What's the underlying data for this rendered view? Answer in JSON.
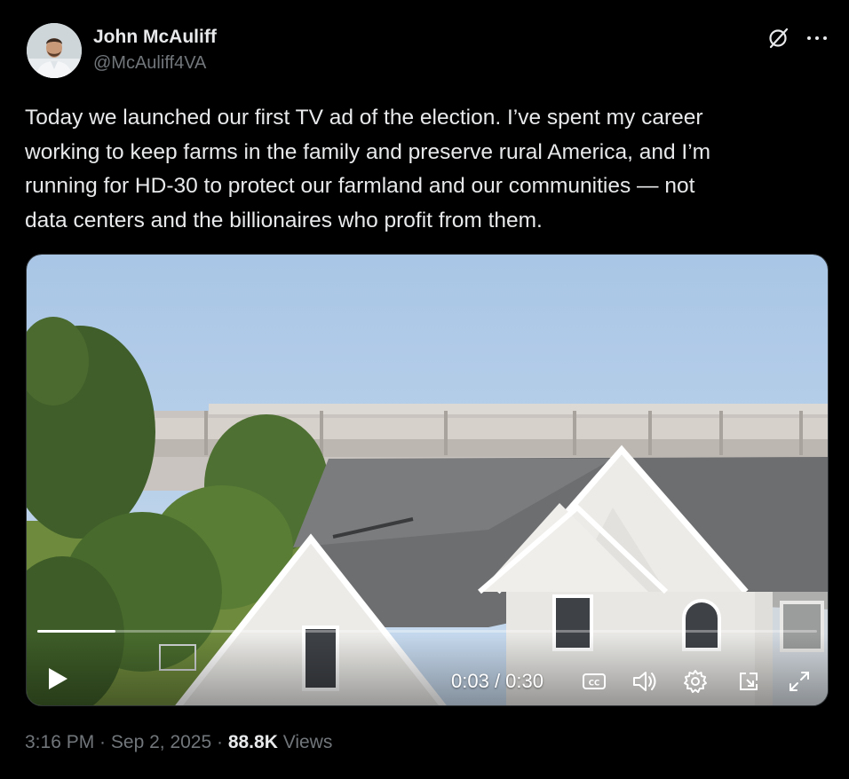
{
  "author": {
    "display_name": "John McAuliff",
    "handle": "@McAuliff4VA"
  },
  "tweet": {
    "text": "Today we launched our first TV ad of the election. I’ve spent my career\nworking to keep farms in the family and preserve rural America, and I’m\nrunning for HD-30 to protect our farmland and our communities — not\ndata centers and the billionaires who profit from them."
  },
  "video": {
    "current_time": "0:03",
    "separator": " / ",
    "duration": "0:30",
    "progress_fraction": 0.1
  },
  "meta": {
    "time": "3:16 PM",
    "dot1": " · ",
    "date": "Sep 2, 2025",
    "dot2": " · ",
    "views_count": "88.8K",
    "views_label": " Views"
  },
  "icons": {
    "grok": "grok-icon",
    "more": "more-icon",
    "play": "play-icon",
    "captions": "closed-captions-icon",
    "volume": "volume-icon",
    "settings": "settings-icon",
    "pip": "picture-in-picture-icon",
    "fullscreen": "fullscreen-icon"
  },
  "colors": {
    "background": "#000000",
    "primary_text": "#e7e9ea",
    "secondary_text": "#71767b"
  }
}
